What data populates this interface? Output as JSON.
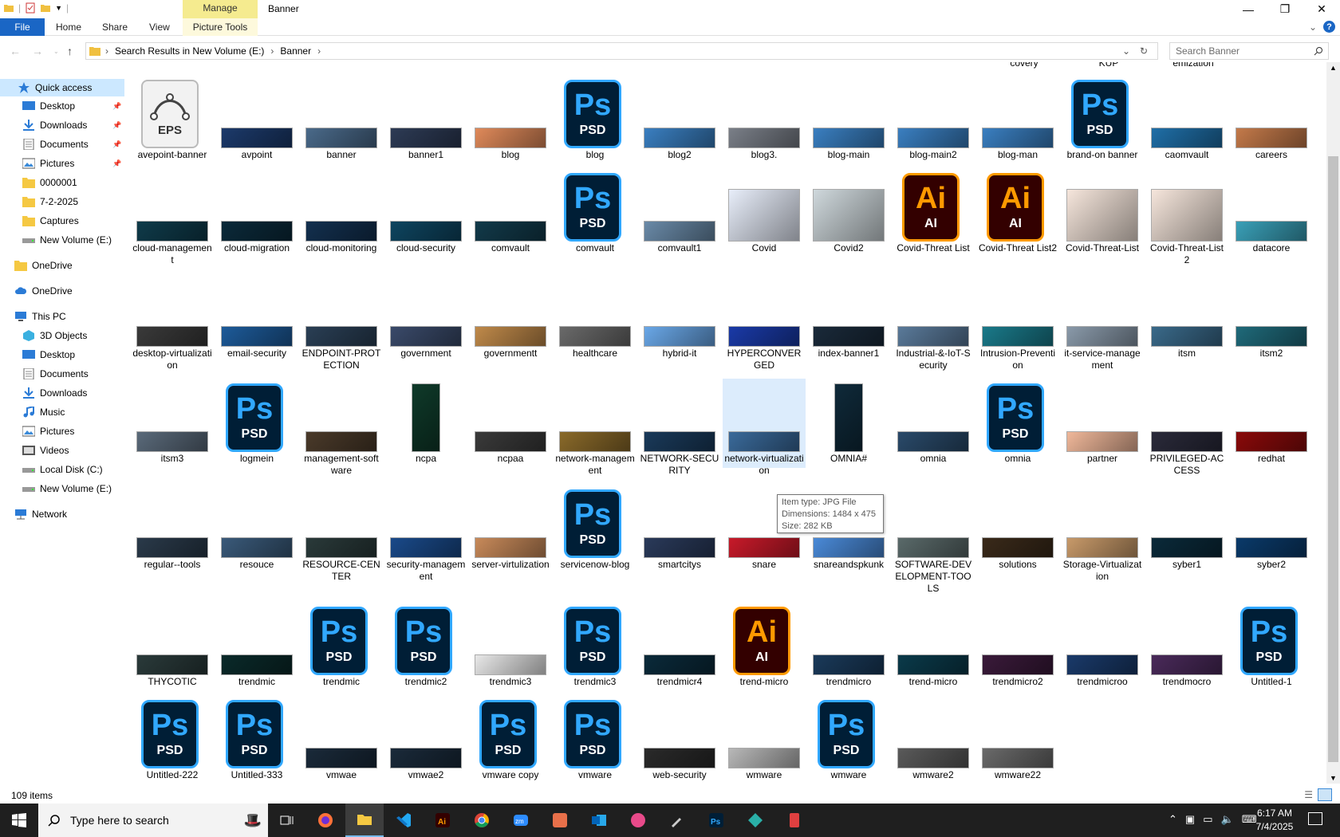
{
  "window": {
    "title": "Banner",
    "context_tab": "Manage",
    "minimize": "—",
    "maximize": "❐",
    "close": "✕"
  },
  "ribbon": {
    "tabs": [
      "File",
      "Home",
      "Share",
      "View",
      "Picture Tools"
    ],
    "expand": "⌄",
    "help": "?"
  },
  "address": {
    "path": [
      "Search Results in New Volume (E:)",
      "Banner"
    ],
    "search_placeholder": "Search Banner"
  },
  "nav": [
    {
      "label": "Quick access",
      "type": "star",
      "pinned": false,
      "sel": true
    },
    {
      "label": "Desktop",
      "type": "desk",
      "pinned": true
    },
    {
      "label": "Downloads",
      "type": "down",
      "pinned": true
    },
    {
      "label": "Documents",
      "type": "doc",
      "pinned": true
    },
    {
      "label": "Pictures",
      "type": "pic",
      "pinned": true
    },
    {
      "label": "0000001",
      "type": "folder"
    },
    {
      "label": "7-2-2025",
      "type": "folder"
    },
    {
      "label": "Captures",
      "type": "folder"
    },
    {
      "label": "New Volume (E:)",
      "type": "drive"
    },
    {
      "label": "OneDrive",
      "type": "folder"
    },
    {
      "label": "OneDrive",
      "type": "cloud"
    },
    {
      "label": "This PC",
      "type": "pc"
    },
    {
      "label": "3D Objects",
      "type": "3d"
    },
    {
      "label": "Desktop",
      "type": "desk"
    },
    {
      "label": "Documents",
      "type": "doc"
    },
    {
      "label": "Downloads",
      "type": "down"
    },
    {
      "label": "Music",
      "type": "music"
    },
    {
      "label": "Pictures",
      "type": "pic"
    },
    {
      "label": "Videos",
      "type": "video"
    },
    {
      "label": "Local Disk (C:)",
      "type": "drive"
    },
    {
      "label": "New Volume (E:)",
      "type": "drive"
    },
    {
      "label": "Network",
      "type": "net"
    }
  ],
  "partial_top": [
    "covery",
    "KUP",
    "emization"
  ],
  "rows": [
    [
      {
        "n": "avepoint-banner",
        "t": "eps"
      },
      {
        "n": "avpoint",
        "t": "img",
        "c": "#1c3a6b"
      },
      {
        "n": "banner",
        "t": "img",
        "c": "#4a6a8a"
      },
      {
        "n": "banner1",
        "t": "img",
        "c": "#2d3b55"
      },
      {
        "n": "blog",
        "t": "img",
        "c": "#e08a5a"
      },
      {
        "n": "blog",
        "t": "psd"
      },
      {
        "n": "blog2",
        "t": "img",
        "c": "#3a7fc1"
      },
      {
        "n": "blog3.",
        "t": "img",
        "c": "#7a7f88"
      },
      {
        "n": "blog-main",
        "t": "img",
        "c": "#3a7fc1"
      },
      {
        "n": "blog-main2",
        "t": "img",
        "c": "#3a7fc1"
      },
      {
        "n": "blog-man",
        "t": "img",
        "c": "#3a7fc1"
      },
      {
        "n": "brand-on banner",
        "t": "psd"
      },
      {
        "n": "caomvault",
        "t": "img",
        "c": "#1f6fa8"
      },
      {
        "n": "careers",
        "t": "img",
        "c": "#c47a4a"
      }
    ],
    [
      {
        "n": "cloud-management",
        "t": "img",
        "c": "#0f3b4a"
      },
      {
        "n": "cloud-migration",
        "t": "img",
        "c": "#0b2a3a"
      },
      {
        "n": "cloud-monitoring",
        "t": "img",
        "c": "#13304f"
      },
      {
        "n": "cloud-security",
        "t": "img",
        "c": "#0e4560"
      },
      {
        "n": "comvault",
        "t": "img",
        "c": "#123a4a"
      },
      {
        "n": "comvault",
        "t": "psd"
      },
      {
        "n": "comvault1",
        "t": "img",
        "c": "#6a8aa8"
      },
      {
        "n": "Covid",
        "t": "img",
        "c": "#e8eefa",
        "h": 66
      },
      {
        "n": "Covid2",
        "t": "img",
        "c": "#cfd8dc",
        "h": 66
      },
      {
        "n": "Covid-Threat List",
        "t": "ai"
      },
      {
        "n": "Covid-Threat List2",
        "t": "ai"
      },
      {
        "n": "Covid-Threat-List",
        "t": "img",
        "c": "#f6e6dc",
        "h": 66
      },
      {
        "n": "Covid-Threat-List 2",
        "t": "img",
        "c": "#f6e6dc",
        "h": 66
      },
      {
        "n": "datacore",
        "t": "img",
        "c": "#3aa0b8"
      }
    ],
    [
      {
        "n": "desktop-virtualization",
        "t": "img",
        "c": "#3a3a3a"
      },
      {
        "n": "email-security",
        "t": "img",
        "c": "#1d5b9a"
      },
      {
        "n": "ENDPOINT-PROTECTION",
        "t": "img",
        "c": "#2a3f55"
      },
      {
        "n": "government",
        "t": "img",
        "c": "#3a4a6a"
      },
      {
        "n": "governmentt",
        "t": "img",
        "c": "#c08a4a"
      },
      {
        "n": "healthcare",
        "t": "img",
        "c": "#6a6a6a"
      },
      {
        "n": "hybrid-it",
        "t": "img",
        "c": "#6aa8e8"
      },
      {
        "n": "HYPERCONVERGED",
        "t": "img",
        "c": "#1a3aa8"
      },
      {
        "n": "index-banner1",
        "t": "img",
        "c": "#1a2a3a"
      },
      {
        "n": "Industrial-&-IoT-Security",
        "t": "img",
        "c": "#5a7a9a"
      },
      {
        "n": "Intrusion-Prevention",
        "t": "img",
        "c": "#1a7a8a"
      },
      {
        "n": "it-service-management",
        "t": "img",
        "c": "#8a9aaa"
      },
      {
        "n": "itsm",
        "t": "img",
        "c": "#3a6a8a"
      },
      {
        "n": "itsm2",
        "t": "img",
        "c": "#1f6a7a"
      }
    ],
    [
      {
        "n": "itsm3",
        "t": "img",
        "c": "#5a6a7a"
      },
      {
        "n": "logmein",
        "t": "psd"
      },
      {
        "n": "management-software",
        "t": "img",
        "c": "#4a3a2a"
      },
      {
        "n": "ncpa",
        "t": "img",
        "c": "#0f3a2a",
        "h": 86,
        "w": 36
      },
      {
        "n": "ncpaa",
        "t": "img",
        "c": "#3a3a3a"
      },
      {
        "n": "network-management",
        "t": "img",
        "c": "#8a6a2a"
      },
      {
        "n": "NETWORK-SECURITY",
        "t": "img",
        "c": "#1a3a5a"
      },
      {
        "n": "network-virtualization",
        "t": "img",
        "c": "#3a6a9a",
        "sel": true
      },
      {
        "n": "OMNIA#",
        "t": "img",
        "c": "#0f2a3a",
        "h": 86,
        "w": 36
      },
      {
        "n": "omnia",
        "t": "img",
        "c": "#2a4a6a"
      },
      {
        "n": "omnia",
        "t": "psd"
      },
      {
        "n": "partner",
        "t": "img",
        "c": "#f0b89a"
      },
      {
        "n": "PRIVILEGED-ACCESS",
        "t": "img",
        "c": "#2a2a3a"
      },
      {
        "n": "redhat",
        "t": "img",
        "c": "#8a0a0a"
      }
    ],
    [
      {
        "n": "regular--tools",
        "t": "img",
        "c": "#2a3a4a"
      },
      {
        "n": "resouce",
        "t": "img",
        "c": "#3a5a7a"
      },
      {
        "n": "RESOURCE-CENTER",
        "t": "img",
        "c": "#2a3a3a"
      },
      {
        "n": "security-management",
        "t": "img",
        "c": "#1a4a8a"
      },
      {
        "n": "server-virtulization",
        "t": "img",
        "c": "#c88a5a"
      },
      {
        "n": "servicenow-blog",
        "t": "psd"
      },
      {
        "n": "smartcitys",
        "t": "img",
        "c": "#2a3a5a"
      },
      {
        "n": "snare",
        "t": "img",
        "c": "#c81a2a"
      },
      {
        "n": "snareandspkunk",
        "t": "img",
        "c": "#4a8ad8"
      },
      {
        "n": "SOFTWARE-DEVELOPMENT-TOOLS",
        "t": "img",
        "c": "#5a6a6a"
      },
      {
        "n": "solutions",
        "t": "img",
        "c": "#3a2a1a"
      },
      {
        "n": "Storage-Virtualization",
        "t": "img",
        "c": "#c89a6a"
      },
      {
        "n": "syber1",
        "t": "img",
        "c": "#0a2a3a"
      },
      {
        "n": "syber2",
        "t": "img",
        "c": "#0a3a6a"
      }
    ],
    [
      {
        "n": "THYCOTIC",
        "t": "img",
        "c": "#2a3a3a"
      },
      {
        "n": "trendmic",
        "t": "img",
        "c": "#0a2a2a"
      },
      {
        "n": "trendmic",
        "t": "psd"
      },
      {
        "n": "trendmic2",
        "t": "psd"
      },
      {
        "n": "trendmic3",
        "t": "img",
        "c": "#e8e8e8"
      },
      {
        "n": "trendmic3",
        "t": "psd"
      },
      {
        "n": "trendmicr4",
        "t": "img",
        "c": "#0a2a3a"
      },
      {
        "n": "trend-micro",
        "t": "ai"
      },
      {
        "n": "trendmicro",
        "t": "img",
        "c": "#1a3a5a"
      },
      {
        "n": "trend-micro",
        "t": "img",
        "c": "#0a3a4a"
      },
      {
        "n": "trendmicro2",
        "t": "img",
        "c": "#3a1a3a"
      },
      {
        "n": "trendmicroo",
        "t": "img",
        "c": "#1a3a6a"
      },
      {
        "n": "trendmocro",
        "t": "img",
        "c": "#4a2a5a"
      },
      {
        "n": "Untitled-1",
        "t": "psd"
      }
    ],
    [
      {
        "n": "Untitled-222",
        "t": "psd"
      },
      {
        "n": "Untitled-333",
        "t": "psd"
      },
      {
        "n": "vmwae",
        "t": "img",
        "c": "#1a2a3a"
      },
      {
        "n": "vmwae2",
        "t": "img",
        "c": "#1a2a3a"
      },
      {
        "n": "vmware copy",
        "t": "psd"
      },
      {
        "n": "vmware",
        "t": "psd"
      },
      {
        "n": "web-security",
        "t": "img",
        "c": "#2a2a2a"
      },
      {
        "n": "wmware",
        "t": "img",
        "c": "#b8b8b8"
      },
      {
        "n": "wmware",
        "t": "psd"
      },
      {
        "n": "wmware2",
        "t": "img",
        "c": "#5a5a5a"
      },
      {
        "n": "wmware22",
        "t": "img",
        "c": "#6a6a6a"
      }
    ]
  ],
  "tooltip": [
    "Item type: JPG File",
    "Dimensions: 1484 x 475",
    "Size: 282 KB"
  ],
  "status": {
    "count": "109 items"
  },
  "taskbar": {
    "search_placeholder": "Type here to search",
    "time": "6:17 AM",
    "date": "7/4/2025",
    "apps": [
      "firefox",
      "file-explorer",
      "vscode",
      "illustrator",
      "chrome",
      "zoom",
      "app-orange",
      "outlook",
      "app-pink",
      "brush",
      "photoshop",
      "app-teal",
      "app-red"
    ]
  }
}
